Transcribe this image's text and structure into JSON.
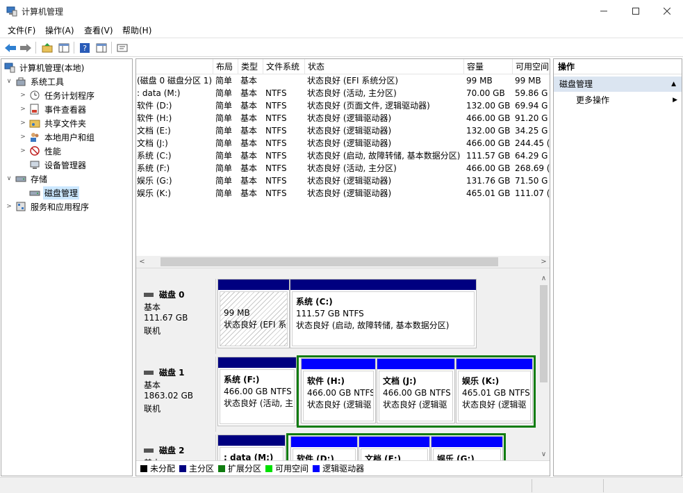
{
  "window": {
    "title": "计算机管理"
  },
  "menu": [
    "文件(F)",
    "操作(A)",
    "查看(V)",
    "帮助(H)"
  ],
  "tree": [
    {
      "label": "计算机管理(本地)",
      "icon": "computer-management-icon"
    },
    {
      "label": "系统工具",
      "icon": "tools-icon"
    },
    {
      "label": "任务计划程序",
      "icon": "clock-icon"
    },
    {
      "label": "事件查看器",
      "icon": "event-viewer-icon"
    },
    {
      "label": "共享文件夹",
      "icon": "shared-folder-icon"
    },
    {
      "label": "本地用户和组",
      "icon": "users-icon"
    },
    {
      "label": "性能",
      "icon": "performance-icon"
    },
    {
      "label": "设备管理器",
      "icon": "device-manager-icon"
    },
    {
      "label": "存储",
      "icon": "storage-icon"
    },
    {
      "label": "磁盘管理",
      "icon": "disk-management-icon"
    },
    {
      "label": "服务和应用程序",
      "icon": "services-icon"
    }
  ],
  "volumes": {
    "columns": [
      "布局",
      "类型",
      "文件系统",
      "状态",
      "容量",
      "可用空间"
    ],
    "rows": [
      {
        "name": "(磁盘 0 磁盘分区 1)",
        "layout": "简单",
        "type": "基本",
        "fs": "",
        "status": "状态良好 (EFI 系统分区)",
        "capacity": "99 MB",
        "free": "99 MB"
      },
      {
        "name": ": data (M:)",
        "layout": "简单",
        "type": "基本",
        "fs": "NTFS",
        "status": "状态良好 (活动, 主分区)",
        "capacity": "70.00 GB",
        "free": "59.86 G"
      },
      {
        "name": "软件 (D:)",
        "layout": "简单",
        "type": "基本",
        "fs": "NTFS",
        "status": "状态良好 (页面文件, 逻辑驱动器)",
        "capacity": "132.00 GB",
        "free": "69.94 G"
      },
      {
        "name": "软件 (H:)",
        "layout": "简单",
        "type": "基本",
        "fs": "NTFS",
        "status": "状态良好 (逻辑驱动器)",
        "capacity": "466.00 GB",
        "free": "91.20 G"
      },
      {
        "name": "文档 (E:)",
        "layout": "简单",
        "type": "基本",
        "fs": "NTFS",
        "status": "状态良好 (逻辑驱动器)",
        "capacity": "132.00 GB",
        "free": "34.25 G"
      },
      {
        "name": "文档 (J:)",
        "layout": "简单",
        "type": "基本",
        "fs": "NTFS",
        "status": "状态良好 (逻辑驱动器)",
        "capacity": "466.00 GB",
        "free": "244.45 ("
      },
      {
        "name": "系统 (C:)",
        "layout": "简单",
        "type": "基本",
        "fs": "NTFS",
        "status": "状态良好 (启动, 故障转储, 基本数据分区)",
        "capacity": "111.57 GB",
        "free": "64.29 G"
      },
      {
        "name": "系统 (F:)",
        "layout": "简单",
        "type": "基本",
        "fs": "NTFS",
        "status": "状态良好 (活动, 主分区)",
        "capacity": "466.00 GB",
        "free": "268.69 ("
      },
      {
        "name": "娱乐 (G:)",
        "layout": "简单",
        "type": "基本",
        "fs": "NTFS",
        "status": "状态良好 (逻辑驱动器)",
        "capacity": "131.76 GB",
        "free": "71.50 G"
      },
      {
        "name": "娱乐 (K:)",
        "layout": "简单",
        "type": "基本",
        "fs": "NTFS",
        "status": "状态良好 (逻辑驱动器)",
        "capacity": "465.01 GB",
        "free": "111.07 ("
      }
    ]
  },
  "disks": [
    {
      "name": "磁盘 0",
      "kind": "基本",
      "size": "111.67 GB",
      "state": "联机",
      "partitions": [
        {
          "title": "",
          "size": "99 MB",
          "status": "状态良好 (EFI 系统",
          "bar": "#000080",
          "hatched": true
        },
        {
          "title": "系统 (C:)",
          "size": "111.57 GB NTFS",
          "status": "状态良好 (启动, 故障转储, 基本数据分区)",
          "bar": "#000080"
        }
      ]
    },
    {
      "name": "磁盘 1",
      "kind": "基本",
      "size": "1863.02 GB",
      "state": "联机",
      "partitions": [
        {
          "title": "系统 (F:)",
          "size": "466.00 GB NTFS",
          "status": "状态良好 (活动, 主",
          "bar": "#000080"
        },
        {
          "title": "软件 (H:)",
          "size": "466.00 GB NTFS",
          "status": "状态良好 (逻辑驱",
          "bar": "#0000ff"
        },
        {
          "title": "文档 (J:)",
          "size": "466.00 GB NTFS",
          "status": "状态良好 (逻辑驱",
          "bar": "#0000ff"
        },
        {
          "title": "娱乐 (K:)",
          "size": "465.01 GB NTFS",
          "status": "状态良好 (逻辑驱",
          "bar": "#0000ff"
        }
      ]
    },
    {
      "name": "磁盘 2",
      "kind": "基本",
      "size": "",
      "state": "",
      "partitions": [
        {
          "title": ": data (M:)",
          "size": "",
          "status": "",
          "bar": "#000080"
        },
        {
          "title": "软件 (D:)",
          "size": "",
          "status": "",
          "bar": "#0000ff"
        },
        {
          "title": "文档 (E:)",
          "size": "",
          "status": "",
          "bar": "#0000ff"
        },
        {
          "title": "娱乐 (G:)",
          "size": "",
          "status": "",
          "bar": "#0000ff"
        }
      ]
    }
  ],
  "legend": [
    {
      "label": "未分配",
      "color": "#000000"
    },
    {
      "label": "主分区",
      "color": "#000080"
    },
    {
      "label": "扩展分区",
      "color": "#107c10"
    },
    {
      "label": "可用空间",
      "color": "#00e000"
    },
    {
      "label": "逻辑驱动器",
      "color": "#0000ff"
    }
  ],
  "actions": {
    "header": "操作",
    "section": "磁盘管理",
    "item": "更多操作"
  }
}
